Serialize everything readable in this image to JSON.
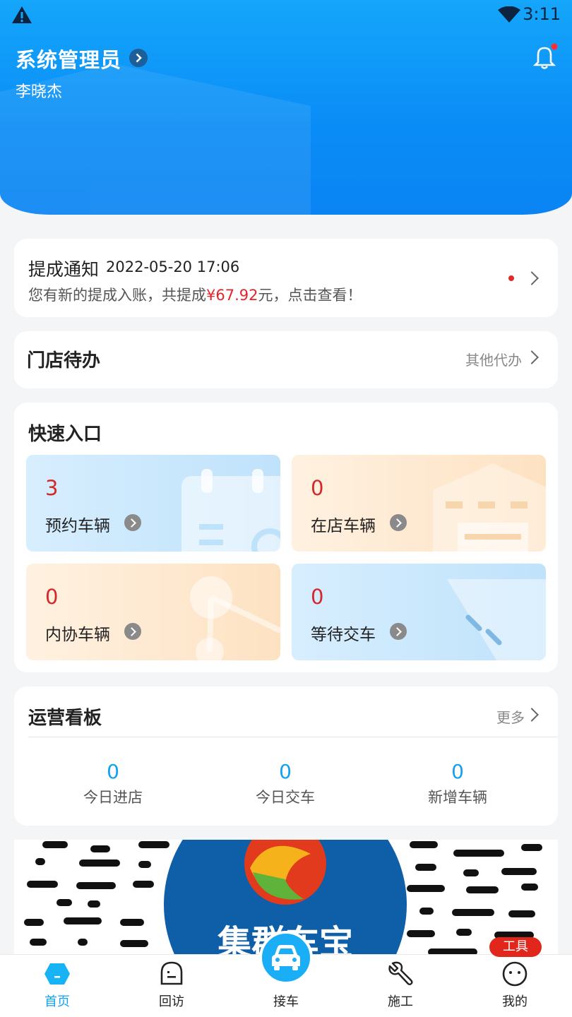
{
  "status_bar": {
    "time": "3:11",
    "icons": [
      "warning-icon",
      "wifi-icon"
    ]
  },
  "header": {
    "role": "系统管理员",
    "user_name": "李晓杰",
    "icons": [
      "chevron-right-icon",
      "bell-icon"
    ]
  },
  "notice": {
    "title": "提成通知",
    "time": "2022-05-20 17:06",
    "text_prefix": "您有新的提成入账，共提成",
    "amount": "¥67.92",
    "text_suffix": "元，点击查看！"
  },
  "store_todo": {
    "title": "门店待办",
    "more": "其他代办"
  },
  "quick_entry": {
    "title": "快速入口",
    "items": [
      {
        "count": "3",
        "label": "预约车辆",
        "icon": "calendar-icon"
      },
      {
        "count": "0",
        "label": "在店车辆",
        "icon": "garage-icon"
      },
      {
        "count": "0",
        "label": "内协车辆",
        "icon": "network-icon"
      },
      {
        "count": "0",
        "label": "等待交车",
        "icon": "handover-icon"
      }
    ]
  },
  "ops_board": {
    "title": "运营看板",
    "more": "更多",
    "stats": [
      {
        "value": "0",
        "label": "今日进店"
      },
      {
        "value": "0",
        "label": "今日交车"
      },
      {
        "value": "0",
        "label": "新增车辆"
      }
    ]
  },
  "banner": {
    "logo_text": "集群车宝"
  },
  "tabbar": {
    "items": [
      {
        "label": "首页",
        "icon": "home-icon",
        "active": true
      },
      {
        "label": "回访",
        "icon": "chat-icon",
        "active": false
      },
      {
        "label": "接车",
        "icon": "car-icon",
        "active": false
      },
      {
        "label": "施工",
        "icon": "wrench-icon",
        "active": false
      },
      {
        "label": "我的",
        "icon": "profile-icon",
        "active": false
      }
    ],
    "badge": "工具"
  },
  "colors": {
    "primary": "#10a3f3",
    "accent_red": "#e2252b",
    "header_blue": "#0a8cf6"
  }
}
